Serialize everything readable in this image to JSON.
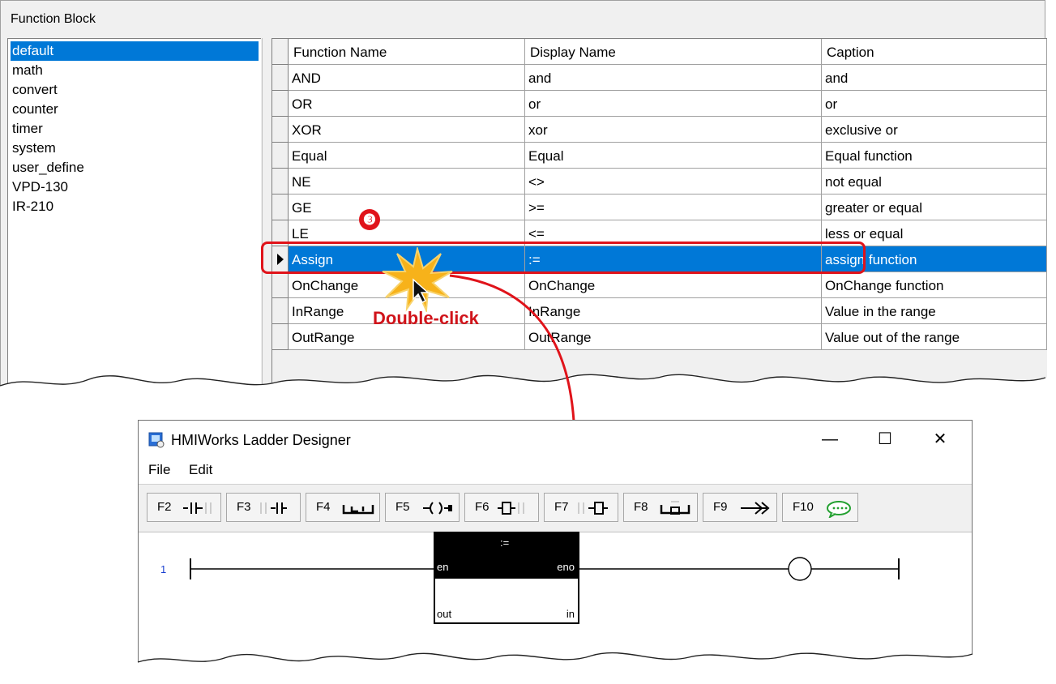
{
  "window1": {
    "title": "Function Block",
    "categories": [
      "default",
      "math",
      "convert",
      "counter",
      "timer",
      "system",
      "user_define",
      "VPD-130",
      "IR-210"
    ],
    "selected_category": "default",
    "columns": [
      "Function Name",
      "Display Name",
      "Caption"
    ],
    "rows": [
      [
        "AND",
        "and",
        "and"
      ],
      [
        "OR",
        "or",
        "or"
      ],
      [
        "XOR",
        "xor",
        "exclusive or"
      ],
      [
        "Equal",
        "Equal",
        "Equal function"
      ],
      [
        "NE",
        "<>",
        "not equal"
      ],
      [
        "GE",
        ">=",
        "greater or equal"
      ],
      [
        "LE",
        "<=",
        "less or equal"
      ],
      [
        "Assign",
        ":=",
        "assign function"
      ],
      [
        "OnChange",
        "OnChange",
        "OnChange function"
      ],
      [
        "InRange",
        "InRange",
        "Value in the range"
      ],
      [
        "OutRange",
        "OutRange",
        "Value out of the range"
      ]
    ],
    "selected_row": "Assign"
  },
  "annotation": {
    "step": "❸",
    "action": "Double-click",
    "color": "#e0131a"
  },
  "window2": {
    "title": "HMIWorks Ladder Designer",
    "controls": {
      "minimize": "—",
      "maximize": "☐",
      "close": "✕"
    },
    "menu": [
      "File",
      "Edit"
    ],
    "toolbar": [
      "F2",
      "F3",
      "F4",
      "F5",
      "F6",
      "F7",
      "F8",
      "F9",
      "F10"
    ],
    "rung_number": "1",
    "block": {
      "name": ":=",
      "pin_en": "en",
      "pin_eno": "eno",
      "pin_out": "out",
      "pin_in": "in"
    }
  },
  "colors": {
    "selection": "#0078d7",
    "rung_number": "#1a3fd0"
  }
}
